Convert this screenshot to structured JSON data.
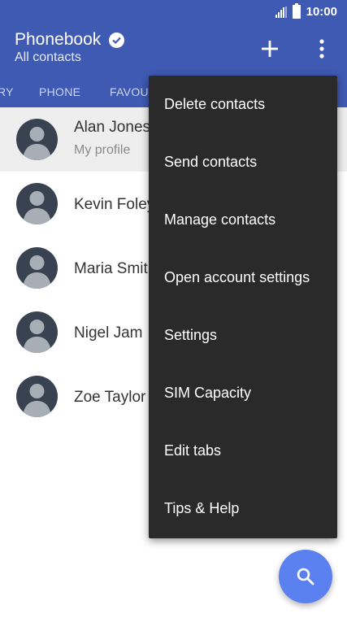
{
  "status_bar": {
    "time": "10:00"
  },
  "app_bar": {
    "title": "Phonebook",
    "subtitle": "All contacts"
  },
  "tabs": [
    "RY",
    "PHONE",
    "FAVOU"
  ],
  "contacts": [
    {
      "name": "Alan Jones",
      "sub": "My profile"
    },
    {
      "name": "Kevin Foley"
    },
    {
      "name": "Maria Smith"
    },
    {
      "name": "Nigel Jam"
    },
    {
      "name": "Zoe Taylor"
    }
  ],
  "menu": {
    "items": [
      "Delete contacts",
      "Send contacts",
      "Manage contacts",
      "Open account settings",
      "Settings",
      "SIM Capacity",
      "Edit tabs",
      "Tips & Help"
    ]
  },
  "colors": {
    "primary": "#3f5ab3",
    "fab": "#5b80f0",
    "menu_bg": "#2a2a2a",
    "avatar": "#384250"
  },
  "icons": [
    "signal-icon",
    "battery-icon",
    "check-icon",
    "add-icon",
    "overflow-menu-icon",
    "person-icon",
    "search-icon"
  ]
}
